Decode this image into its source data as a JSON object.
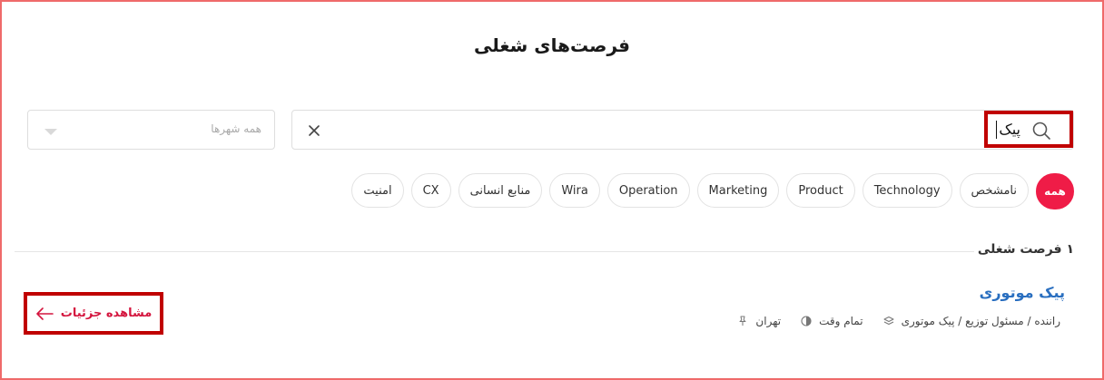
{
  "page": {
    "title": "فرصت‌های شغلی"
  },
  "search": {
    "value": "پیک",
    "icon": "search-icon",
    "clear_icon": "close-icon"
  },
  "city_filter": {
    "placeholder": "همه شهرها",
    "icon": "chevron-down-icon"
  },
  "categories": [
    {
      "label": "همه",
      "active": true
    },
    {
      "label": "نامشخص",
      "active": false
    },
    {
      "label": "Technology",
      "active": false
    },
    {
      "label": "Product",
      "active": false
    },
    {
      "label": "Marketing",
      "active": false
    },
    {
      "label": "Operation",
      "active": false
    },
    {
      "label": "Wira",
      "active": false
    },
    {
      "label": "منابع انسانی",
      "active": false
    },
    {
      "label": "CX",
      "active": false
    },
    {
      "label": "امنیت",
      "active": false
    }
  ],
  "results": {
    "count_label": "۱ فرصت شغلی",
    "jobs": [
      {
        "title": "پیک موتوری",
        "location": "تهران",
        "type": "تمام وقت",
        "category": "راننده / مسئول توزیع / پیک موتوری",
        "details_label": "مشاهده جزئیات"
      }
    ]
  },
  "colors": {
    "accent": "#ef1c47",
    "link": "#2a6fc0",
    "highlight_box": "#c00000"
  }
}
